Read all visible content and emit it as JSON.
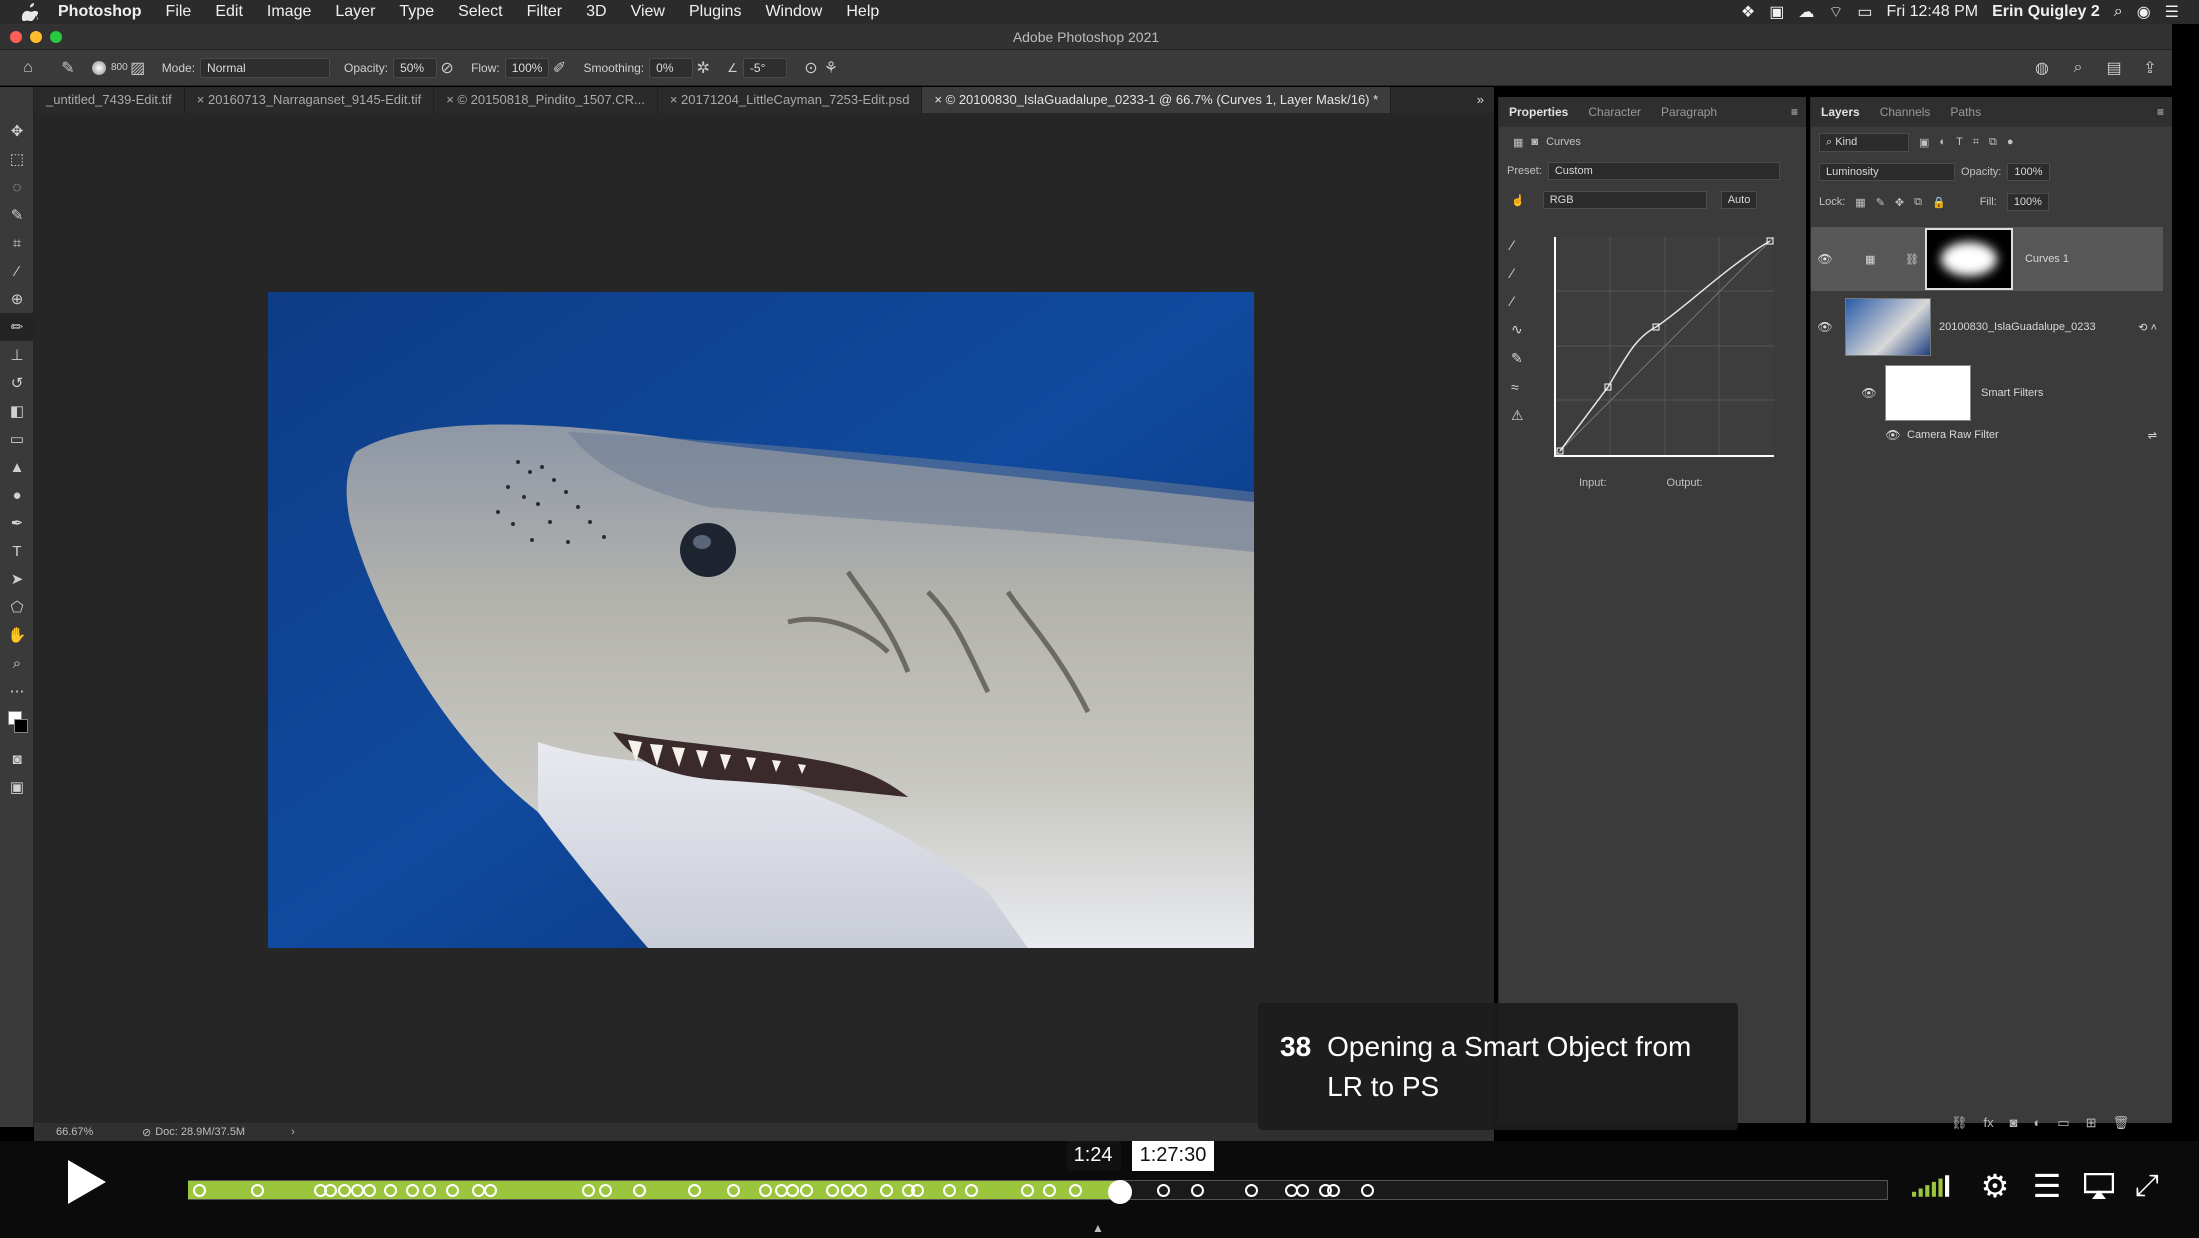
{
  "menubar": {
    "app": "Photoshop",
    "menus": [
      "File",
      "Edit",
      "Image",
      "Layer",
      "Type",
      "Select",
      "Filter",
      "3D",
      "View",
      "Plugins",
      "Window",
      "Help"
    ],
    "clock": "Fri 12:48 PM",
    "user": "Erin Quigley 2"
  },
  "window": {
    "title": "Adobe Photoshop 2021"
  },
  "options": {
    "brush_size": "800",
    "mode_label": "Mode:",
    "mode_value": "Normal",
    "opacity_label": "Opacity:",
    "opacity_value": "50%",
    "flow_label": "Flow:",
    "flow_value": "100%",
    "smoothing_label": "Smoothing:",
    "smoothing_value": "0%",
    "angle_value": "-5°"
  },
  "tabs": [
    "_untitled_7439-Edit.tif",
    "20160713_Narraganset_9145-Edit.tif",
    "© 20150818_Pindito_1507.CR...",
    "20171204_LittleCayman_7253-Edit.psd",
    "© 20100830_IslaGuadalupe_0233-1 @ 66.7% (Curves 1, Layer Mask/16) *"
  ],
  "properties": {
    "tabs": [
      "Properties",
      "Character",
      "Paragraph"
    ],
    "adjustment": "Curves",
    "preset_label": "Preset:",
    "preset_value": "Custom",
    "channel_value": "RGB",
    "auto_label": "Auto",
    "input_label": "Input:",
    "output_label": "Output:"
  },
  "layers": {
    "tabs": [
      "Layers",
      "Channels",
      "Paths"
    ],
    "filter_kind": "Kind",
    "blend_mode": "Luminosity",
    "opacity_label": "Opacity:",
    "opacity_value": "100%",
    "lock_label": "Lock:",
    "fill_label": "Fill:",
    "fill_value": "100%",
    "items": [
      {
        "name": "Curves 1"
      },
      {
        "name": "20100830_IslaGuadalupe_0233"
      },
      {
        "name": "Smart Filters"
      },
      {
        "name": "Camera Raw Filter"
      }
    ]
  },
  "status": {
    "zoom": "66.67%",
    "doc": "Doc: 28.9M/37.5M"
  },
  "lesson": {
    "number": "38",
    "title": "Opening a Smart Object from LR to PS"
  },
  "video": {
    "current_time": "1:24",
    "hover_time": "1:27:30",
    "progress": 0.548,
    "accent": "#9bc53d"
  }
}
